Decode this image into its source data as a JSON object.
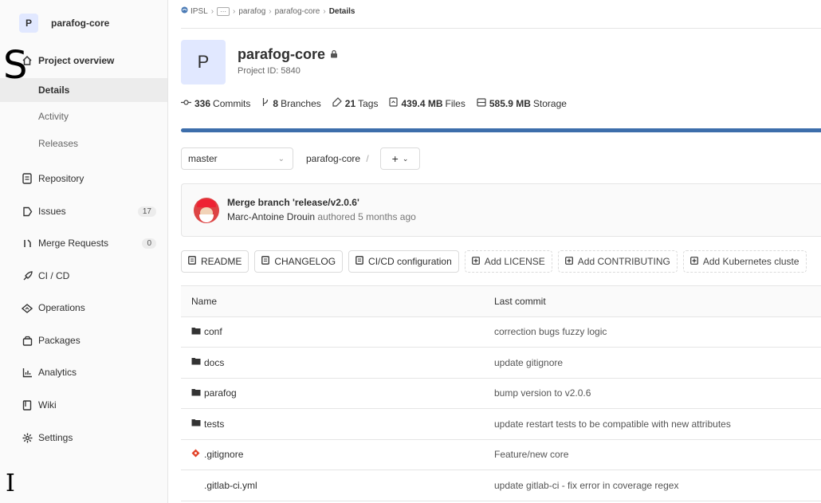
{
  "sidebar": {
    "project_initial": "P",
    "project_name": "parafog-core",
    "items": [
      {
        "label": "Project overview",
        "icon": "home-icon"
      },
      {
        "label": "Details"
      },
      {
        "label": "Activity"
      },
      {
        "label": "Releases"
      },
      {
        "label": "Repository",
        "icon": "doc-icon"
      },
      {
        "label": "Issues",
        "icon": "issues-icon",
        "count": "17"
      },
      {
        "label": "Merge Requests",
        "icon": "merge-request-icon",
        "count": "0"
      },
      {
        "label": "CI / CD",
        "icon": "rocket-icon"
      },
      {
        "label": "Operations",
        "icon": "cloud-icon"
      },
      {
        "label": "Packages",
        "icon": "package-icon"
      },
      {
        "label": "Analytics",
        "icon": "chart-icon"
      },
      {
        "label": "Wiki",
        "icon": "book-icon"
      },
      {
        "label": "Settings",
        "icon": "gear-icon"
      }
    ],
    "overlay_s": "S",
    "overlay_i": "I"
  },
  "breadcrumb": {
    "group": "IPSL",
    "more": "···",
    "subgroup": "parafog",
    "project": "parafog-core",
    "current": "Details"
  },
  "project": {
    "initial": "P",
    "name": "parafog-core",
    "id_text": "Project ID: 5840"
  },
  "stats": {
    "commits_count": "336",
    "commits_label": "Commits",
    "branches_count": "8",
    "branches_label": "Branches",
    "tags_count": "21",
    "tags_label": "Tags",
    "files_size": "439.4 MB",
    "files_label": "Files",
    "storage_size": "585.9 MB",
    "storage_label": "Storage"
  },
  "repo": {
    "branch": "master",
    "path": "parafog-core",
    "path_sep": "/",
    "add_label": "+",
    "storage_fill_fraction": 1.0,
    "storage_color": "#3d6eab"
  },
  "last_commit": {
    "title": "Merge branch 'release/v2.0.6'",
    "author": "Marc-Antoine Drouin",
    "meta": "authored 5 months ago"
  },
  "quick_buttons": [
    {
      "label": "README",
      "dashed": false
    },
    {
      "label": "CHANGELOG",
      "dashed": false
    },
    {
      "label": "CI/CD configuration",
      "dashed": false
    },
    {
      "label": "Add LICENSE",
      "dashed": true
    },
    {
      "label": "Add CONTRIBUTING",
      "dashed": true
    },
    {
      "label": "Add Kubernetes cluste",
      "dashed": true
    }
  ],
  "file_table": {
    "headers": [
      "Name",
      "Last commit"
    ],
    "rows": [
      {
        "name": "conf",
        "type": "folder",
        "commit": "correction bugs fuzzy logic"
      },
      {
        "name": "docs",
        "type": "folder",
        "commit": "update gitignore"
      },
      {
        "name": "parafog",
        "type": "folder",
        "commit": "bump version to v2.0.6"
      },
      {
        "name": "tests",
        "type": "folder",
        "commit": "update restart tests to be compatible with new attributes"
      },
      {
        "name": ".gitignore",
        "type": "git",
        "commit": "Feature/new core"
      },
      {
        "name": ".gitlab-ci.yml",
        "type": "file",
        "commit": "update gitlab-ci - fix error in coverage regex"
      }
    ]
  }
}
